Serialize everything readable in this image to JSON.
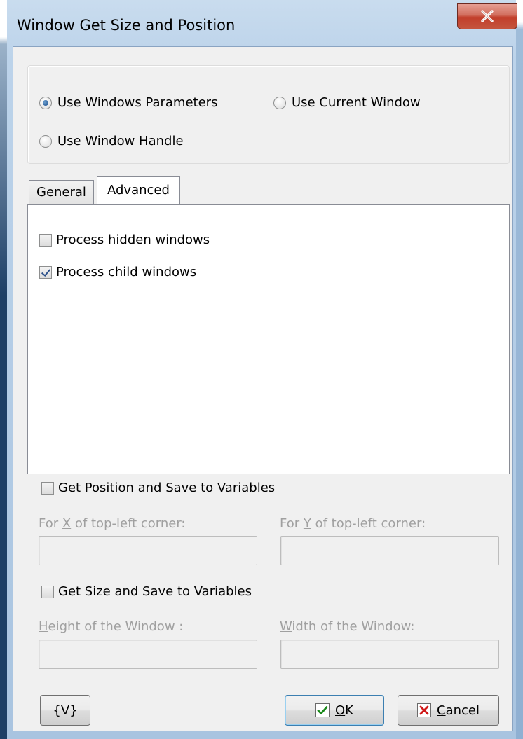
{
  "window": {
    "title": "Window Get Size and Position"
  },
  "mode": {
    "options": [
      {
        "label": "Use Windows Parameters",
        "selected": true
      },
      {
        "label": "Use Current Window",
        "selected": false
      },
      {
        "label": "Use Window Handle",
        "selected": false
      }
    ]
  },
  "tabs": [
    {
      "label": "General",
      "active": false
    },
    {
      "label": "Advanced",
      "active": true
    }
  ],
  "advanced": {
    "process_hidden": {
      "label": "Process hidden windows",
      "checked": false
    },
    "process_child": {
      "label": "Process child windows",
      "checked": true
    }
  },
  "position": {
    "label": "Get Position and Save to Variables",
    "checked": false,
    "x_label_pre": "For ",
    "x_label_key": "X",
    "x_label_post": " of top-left corner:",
    "x_value": "",
    "y_label_pre": "For ",
    "y_label_key": "Y",
    "y_label_post": " of top-left corner:",
    "y_value": ""
  },
  "size": {
    "label": "Get Size and Save to Variables",
    "checked": false,
    "height_key": "H",
    "height_rest": "eight of the Window :",
    "height_value": "",
    "width_key": "W",
    "width_rest": "idth of the Window:",
    "width_value": ""
  },
  "buttons": {
    "variables": "{V}",
    "ok_key": "O",
    "ok_rest": "K",
    "cancel_key": "C",
    "cancel_rest": "ancel"
  },
  "colors": {
    "accent": "#1b4d8a",
    "close": "#c4553e"
  }
}
